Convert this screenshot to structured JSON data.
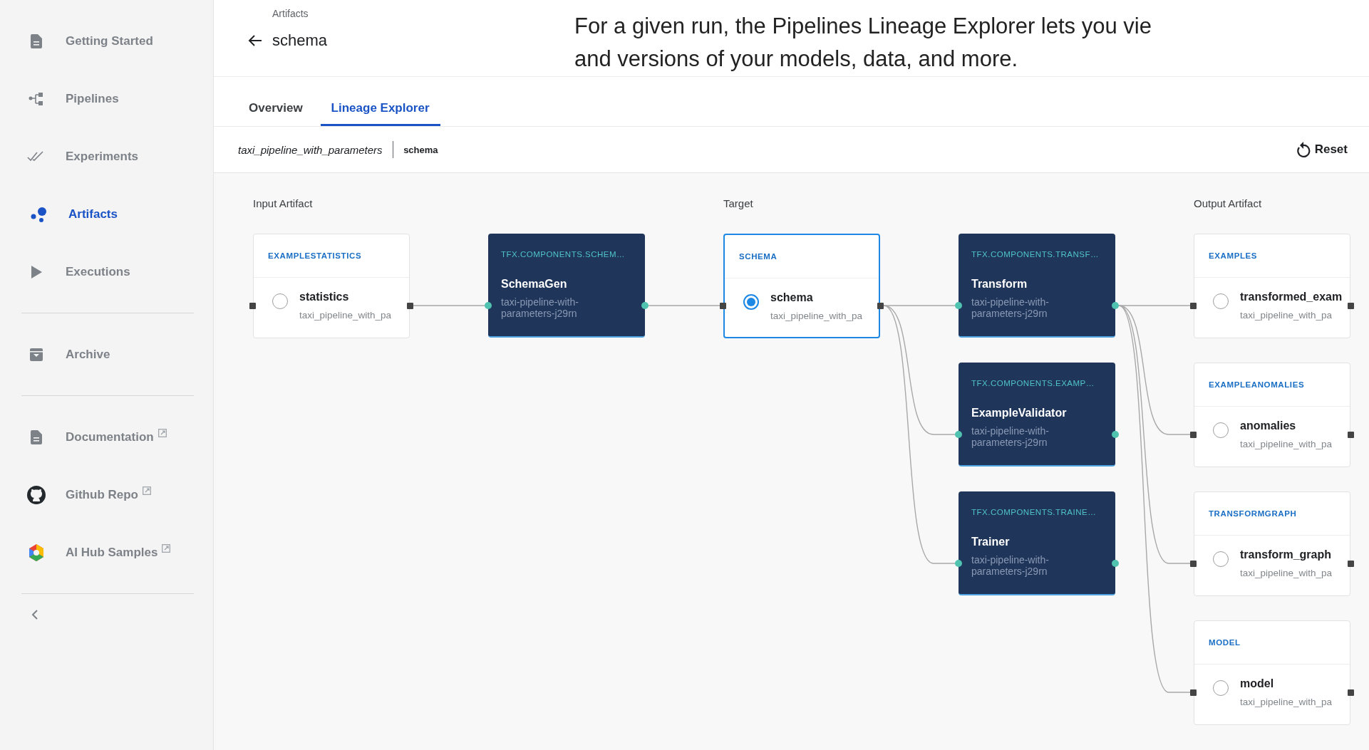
{
  "sidebar": {
    "groups": [
      {
        "items": [
          {
            "label": "Getting Started",
            "selected": false,
            "external": false
          },
          {
            "label": "Pipelines",
            "selected": false,
            "external": false
          },
          {
            "label": "Experiments",
            "selected": false,
            "external": false
          },
          {
            "label": "Artifacts",
            "selected": true,
            "external": false
          },
          {
            "label": "Executions",
            "selected": false,
            "external": false
          }
        ]
      },
      {
        "items": [
          {
            "label": "Archive",
            "selected": false,
            "external": false
          }
        ]
      },
      {
        "items": [
          {
            "label": "Documentation",
            "selected": false,
            "external": true
          },
          {
            "label": "Github Repo",
            "selected": false,
            "external": true
          },
          {
            "label": "AI Hub Samples",
            "selected": false,
            "external": true
          }
        ]
      }
    ]
  },
  "header": {
    "breadcrumb": "Artifacts",
    "title": "schema"
  },
  "caption": [
    "For a given run, the Pipelines Lineage Explorer lets you vie",
    "and versions of your models, data, and more."
  ],
  "tabs": [
    {
      "label": "Overview",
      "selected": false
    },
    {
      "label": "Lineage Explorer",
      "selected": true
    }
  ],
  "toolbar": {
    "pipeline": "taxi_pipeline_with_parameters",
    "artifact": "schema",
    "reset": "Reset"
  },
  "lineage": {
    "columns": [
      {
        "heading": "Input Artifact",
        "nodes": [
          {
            "kind": "artifact",
            "type": "EXAMPLESTATISTICS",
            "name": "statistics",
            "pipeline": "taxi_pipeline_with_pa",
            "selected": false
          }
        ]
      },
      {
        "nodes": [
          {
            "kind": "execution",
            "type": "TFX.COMPONENTS.SCHEM…",
            "name": "SchemaGen",
            "run": "taxi-pipeline-with-parameters-j29rn"
          }
        ]
      },
      {
        "heading": "Target",
        "nodes": [
          {
            "kind": "artifact",
            "type": "SCHEMA",
            "name": "schema",
            "pipeline": "taxi_pipeline_with_pa",
            "selected": true
          }
        ]
      },
      {
        "nodes": [
          {
            "kind": "execution",
            "type": "TFX.COMPONENTS.TRANSF…",
            "name": "Transform",
            "run": "taxi-pipeline-with-parameters-j29rn"
          },
          {
            "kind": "execution",
            "type": "TFX.COMPONENTS.EXAMP…",
            "name": "ExampleValidator",
            "run": "taxi-pipeline-with-parameters-j29rn"
          },
          {
            "kind": "execution",
            "type": "TFX.COMPONENTS.TRAINE…",
            "name": "Trainer",
            "run": "taxi-pipeline-with-parameters-j29rn"
          }
        ]
      },
      {
        "heading": "Output Artifact",
        "nodes": [
          {
            "kind": "artifact",
            "type": "EXAMPLES",
            "name": "transformed_exam",
            "pipeline": "taxi_pipeline_with_pa",
            "selected": false
          },
          {
            "kind": "artifact",
            "type": "EXAMPLEANOMALIES",
            "name": "anomalies",
            "pipeline": "taxi_pipeline_with_pa",
            "selected": false
          },
          {
            "kind": "artifact",
            "type": "TRANSFORMGRAPH",
            "name": "transform_graph",
            "pipeline": "taxi_pipeline_with_pa",
            "selected": false
          },
          {
            "kind": "artifact",
            "type": "MODEL",
            "name": "model",
            "pipeline": "taxi_pipeline_with_pa",
            "selected": false
          }
        ]
      }
    ]
  }
}
